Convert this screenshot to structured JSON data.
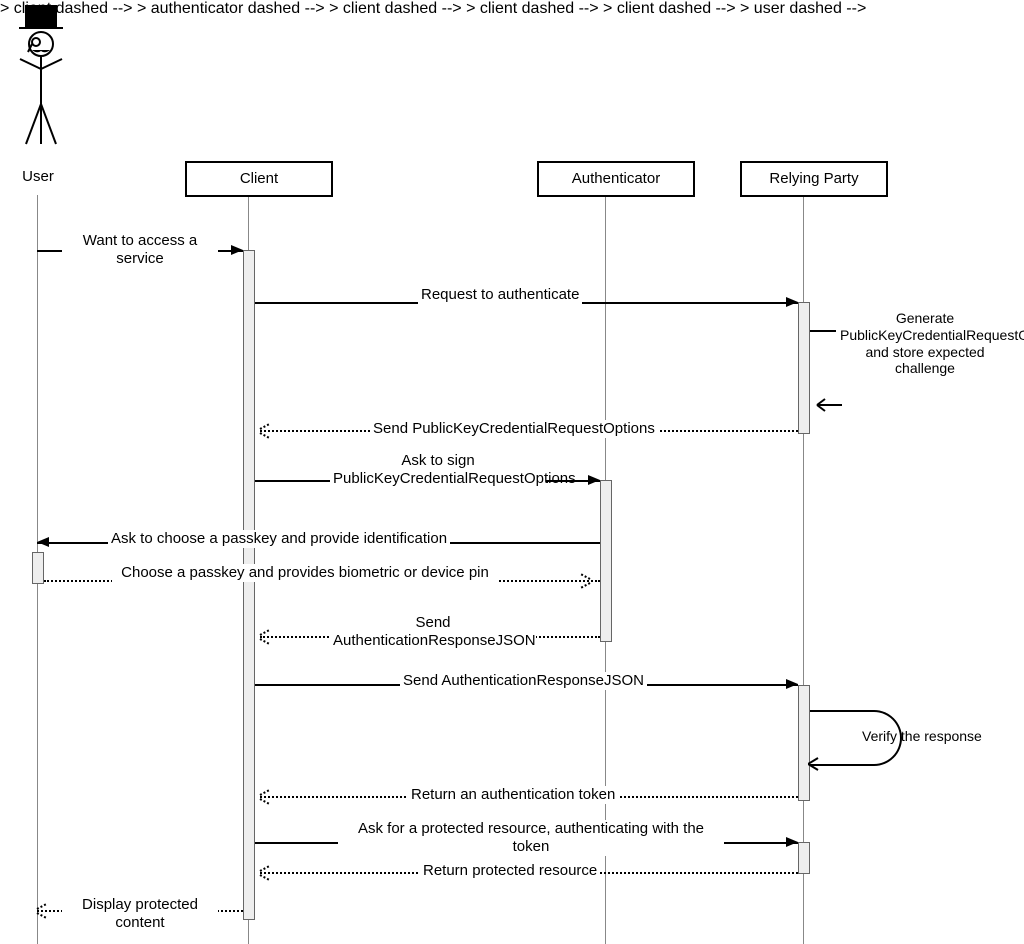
{
  "participants": {
    "user": "User",
    "client": "Client",
    "authenticator": "Authenticator",
    "relying_party": "Relying Party"
  },
  "messages": {
    "m1": "Want to access a service",
    "m2": "Request to authenticate",
    "n1": "Generate PublicKeyCredentialRequestOptions and store expected challenge",
    "m3": "Send PublicKeyCredentialRequestOptions",
    "m4": "Ask to sign PublicKeyCredentialRequestOptions",
    "m5": "Ask to choose a passkey and provide identification",
    "m6": "Choose a passkey and provides biometric or device pin",
    "m7": "Send AuthenticationResponseJSON",
    "m8": "Send AuthenticationResponseJSON",
    "n2": "Verify the response",
    "m9": "Return an authentication token",
    "m10": "Ask for a protected resource, authenticating with the token",
    "m11": "Return protected resource",
    "m12": "Display protected content"
  }
}
